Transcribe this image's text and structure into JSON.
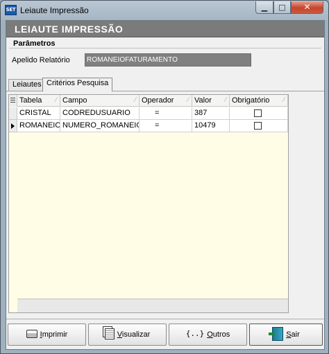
{
  "window": {
    "app_icon_text": "SET",
    "title": "Leiaute Impressão",
    "controls": {
      "minimize": "▁",
      "maximize": "□",
      "close": "✕"
    }
  },
  "header": {
    "title": "LEIAUTE IMPRESSÃO"
  },
  "parametros": {
    "legend": "Parâmetros",
    "apelido_label": "Apelido Relatório",
    "apelido_value": "ROMANEIOFATURAMENTO"
  },
  "tabs": [
    {
      "label": "Leiautes",
      "active": false
    },
    {
      "label": "Critérios Pesquisa",
      "active": true
    }
  ],
  "grid": {
    "columns": [
      "Tabela",
      "Campo",
      "Operador",
      "Valor",
      "Obrigatório"
    ],
    "rows": [
      {
        "tabela": "CRISTAL",
        "campo": "CODREDUSUARIO",
        "operador": "=",
        "valor": "387",
        "obrigatorio": false,
        "current": false
      },
      {
        "tabela": "ROMANEIO",
        "campo": "NUMERO_ROMANEIO",
        "operador": "=",
        "valor": "10479",
        "obrigatorio": false,
        "current": true
      }
    ]
  },
  "buttons": {
    "imprimir": {
      "first": "I",
      "rest": "mprimir",
      "icon": "printer-icon"
    },
    "visualizar": {
      "first": "V",
      "rest": "isualizar",
      "icon": "pages-icon"
    },
    "outros": {
      "icon_text": "{..}",
      "first": "O",
      "rest": "utros",
      "icon": "braces-icon"
    },
    "sair": {
      "first": "S",
      "rest": "air",
      "icon": "exit-door-icon"
    }
  }
}
